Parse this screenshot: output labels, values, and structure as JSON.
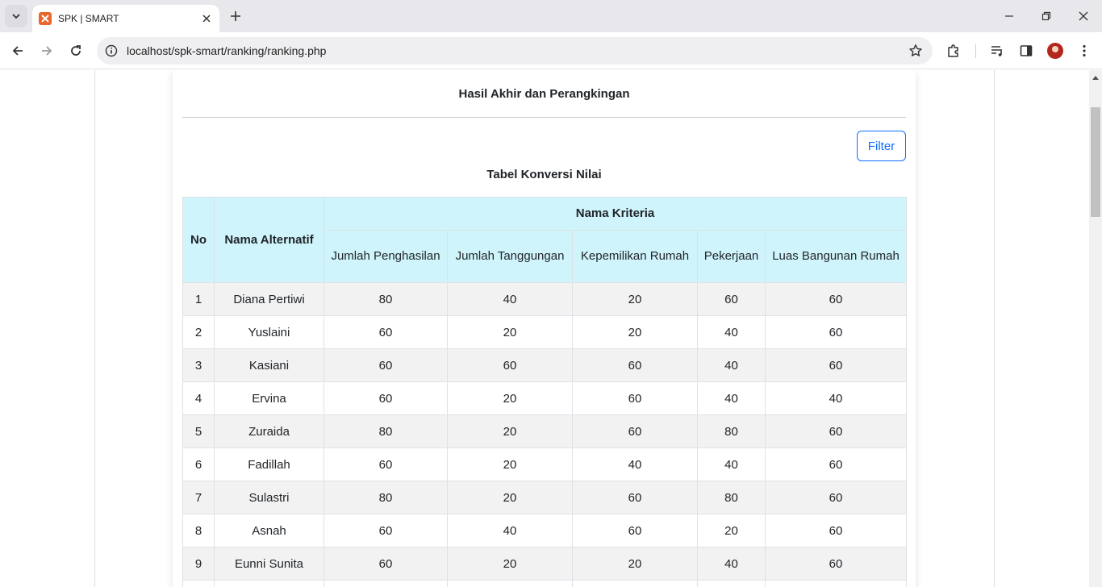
{
  "browser": {
    "tab_title": "SPK | SMART",
    "url": "localhost/spk-smart/ranking/ranking.php"
  },
  "card": {
    "title": "Hasil Akhir dan Perangkingan",
    "filter_label": "Filter",
    "table_title": "Tabel Konversi Nilai"
  },
  "table": {
    "header_no": "No",
    "header_nama_alternatif": "Nama Alternatif",
    "header_nama_kriteria": "Nama Kriteria",
    "criteria": [
      "Jumlah Penghasilan",
      "Jumlah Tanggungan",
      "Kepemilikan Rumah",
      "Pekerjaan",
      "Luas Bangunan Rumah"
    ],
    "rows": [
      {
        "no": "1",
        "nama": "Diana Pertiwi",
        "values": [
          "80",
          "40",
          "20",
          "60",
          "60"
        ]
      },
      {
        "no": "2",
        "nama": "Yuslaini",
        "values": [
          "60",
          "20",
          "20",
          "40",
          "60"
        ]
      },
      {
        "no": "3",
        "nama": "Kasiani",
        "values": [
          "60",
          "60",
          "60",
          "40",
          "60"
        ]
      },
      {
        "no": "4",
        "nama": "Ervina",
        "values": [
          "60",
          "20",
          "60",
          "40",
          "40"
        ]
      },
      {
        "no": "5",
        "nama": "Zuraida",
        "values": [
          "80",
          "20",
          "60",
          "80",
          "60"
        ]
      },
      {
        "no": "6",
        "nama": "Fadillah",
        "values": [
          "60",
          "20",
          "40",
          "40",
          "60"
        ]
      },
      {
        "no": "7",
        "nama": "Sulastri",
        "values": [
          "80",
          "20",
          "60",
          "80",
          "60"
        ]
      },
      {
        "no": "8",
        "nama": "Asnah",
        "values": [
          "60",
          "40",
          "60",
          "20",
          "60"
        ]
      },
      {
        "no": "9",
        "nama": "Eunni Sunita",
        "values": [
          "60",
          "20",
          "20",
          "40",
          "60"
        ]
      },
      {
        "no": "",
        "nama": "",
        "values": [
          "",
          "",
          "",
          "",
          ""
        ]
      }
    ]
  }
}
